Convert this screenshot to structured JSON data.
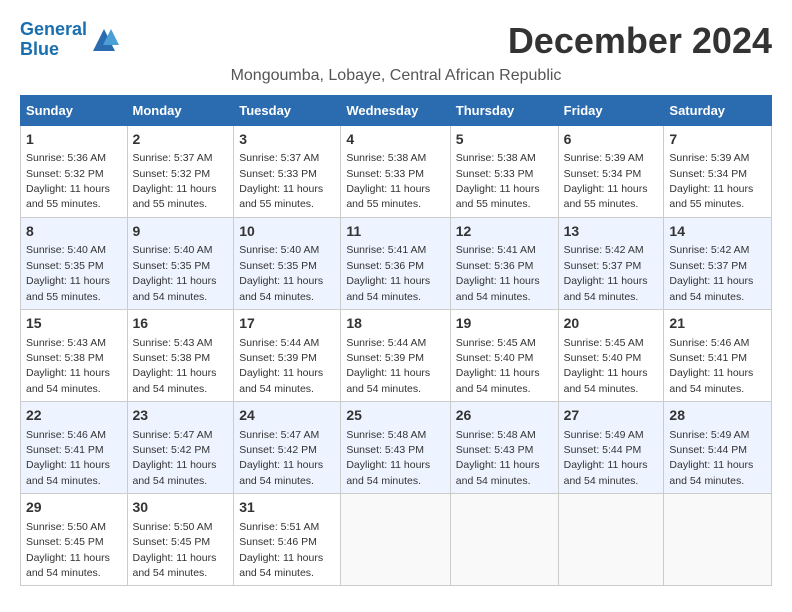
{
  "logo": {
    "line1": "General",
    "line2": "Blue"
  },
  "title": "December 2024",
  "location": "Mongoumba, Lobaye, Central African Republic",
  "headers": [
    "Sunday",
    "Monday",
    "Tuesday",
    "Wednesday",
    "Thursday",
    "Friday",
    "Saturday"
  ],
  "weeks": [
    [
      {
        "day": "1",
        "sunrise": "5:36 AM",
        "sunset": "5:32 PM",
        "daylight": "11 hours and 55 minutes."
      },
      {
        "day": "2",
        "sunrise": "5:37 AM",
        "sunset": "5:32 PM",
        "daylight": "11 hours and 55 minutes."
      },
      {
        "day": "3",
        "sunrise": "5:37 AM",
        "sunset": "5:33 PM",
        "daylight": "11 hours and 55 minutes."
      },
      {
        "day": "4",
        "sunrise": "5:38 AM",
        "sunset": "5:33 PM",
        "daylight": "11 hours and 55 minutes."
      },
      {
        "day": "5",
        "sunrise": "5:38 AM",
        "sunset": "5:33 PM",
        "daylight": "11 hours and 55 minutes."
      },
      {
        "day": "6",
        "sunrise": "5:39 AM",
        "sunset": "5:34 PM",
        "daylight": "11 hours and 55 minutes."
      },
      {
        "day": "7",
        "sunrise": "5:39 AM",
        "sunset": "5:34 PM",
        "daylight": "11 hours and 55 minutes."
      }
    ],
    [
      {
        "day": "8",
        "sunrise": "5:40 AM",
        "sunset": "5:35 PM",
        "daylight": "11 hours and 55 minutes."
      },
      {
        "day": "9",
        "sunrise": "5:40 AM",
        "sunset": "5:35 PM",
        "daylight": "11 hours and 54 minutes."
      },
      {
        "day": "10",
        "sunrise": "5:40 AM",
        "sunset": "5:35 PM",
        "daylight": "11 hours and 54 minutes."
      },
      {
        "day": "11",
        "sunrise": "5:41 AM",
        "sunset": "5:36 PM",
        "daylight": "11 hours and 54 minutes."
      },
      {
        "day": "12",
        "sunrise": "5:41 AM",
        "sunset": "5:36 PM",
        "daylight": "11 hours and 54 minutes."
      },
      {
        "day": "13",
        "sunrise": "5:42 AM",
        "sunset": "5:37 PM",
        "daylight": "11 hours and 54 minutes."
      },
      {
        "day": "14",
        "sunrise": "5:42 AM",
        "sunset": "5:37 PM",
        "daylight": "11 hours and 54 minutes."
      }
    ],
    [
      {
        "day": "15",
        "sunrise": "5:43 AM",
        "sunset": "5:38 PM",
        "daylight": "11 hours and 54 minutes."
      },
      {
        "day": "16",
        "sunrise": "5:43 AM",
        "sunset": "5:38 PM",
        "daylight": "11 hours and 54 minutes."
      },
      {
        "day": "17",
        "sunrise": "5:44 AM",
        "sunset": "5:39 PM",
        "daylight": "11 hours and 54 minutes."
      },
      {
        "day": "18",
        "sunrise": "5:44 AM",
        "sunset": "5:39 PM",
        "daylight": "11 hours and 54 minutes."
      },
      {
        "day": "19",
        "sunrise": "5:45 AM",
        "sunset": "5:40 PM",
        "daylight": "11 hours and 54 minutes."
      },
      {
        "day": "20",
        "sunrise": "5:45 AM",
        "sunset": "5:40 PM",
        "daylight": "11 hours and 54 minutes."
      },
      {
        "day": "21",
        "sunrise": "5:46 AM",
        "sunset": "5:41 PM",
        "daylight": "11 hours and 54 minutes."
      }
    ],
    [
      {
        "day": "22",
        "sunrise": "5:46 AM",
        "sunset": "5:41 PM",
        "daylight": "11 hours and 54 minutes."
      },
      {
        "day": "23",
        "sunrise": "5:47 AM",
        "sunset": "5:42 PM",
        "daylight": "11 hours and 54 minutes."
      },
      {
        "day": "24",
        "sunrise": "5:47 AM",
        "sunset": "5:42 PM",
        "daylight": "11 hours and 54 minutes."
      },
      {
        "day": "25",
        "sunrise": "5:48 AM",
        "sunset": "5:43 PM",
        "daylight": "11 hours and 54 minutes."
      },
      {
        "day": "26",
        "sunrise": "5:48 AM",
        "sunset": "5:43 PM",
        "daylight": "11 hours and 54 minutes."
      },
      {
        "day": "27",
        "sunrise": "5:49 AM",
        "sunset": "5:44 PM",
        "daylight": "11 hours and 54 minutes."
      },
      {
        "day": "28",
        "sunrise": "5:49 AM",
        "sunset": "5:44 PM",
        "daylight": "11 hours and 54 minutes."
      }
    ],
    [
      {
        "day": "29",
        "sunrise": "5:50 AM",
        "sunset": "5:45 PM",
        "daylight": "11 hours and 54 minutes."
      },
      {
        "day": "30",
        "sunrise": "5:50 AM",
        "sunset": "5:45 PM",
        "daylight": "11 hours and 54 minutes."
      },
      {
        "day": "31",
        "sunrise": "5:51 AM",
        "sunset": "5:46 PM",
        "daylight": "11 hours and 54 minutes."
      },
      null,
      null,
      null,
      null
    ]
  ]
}
